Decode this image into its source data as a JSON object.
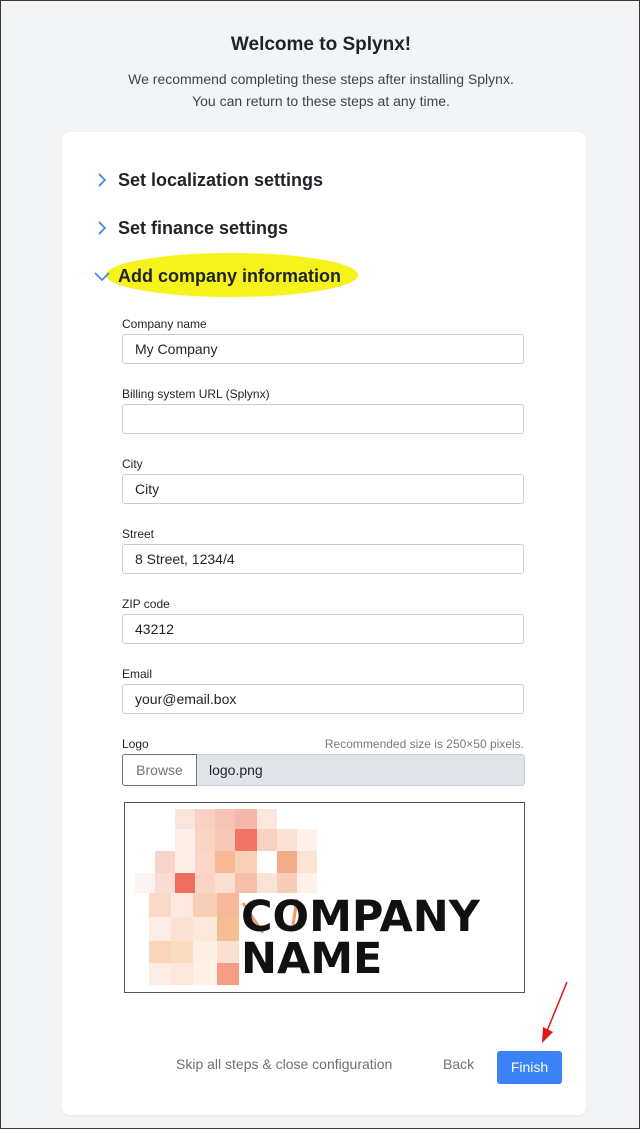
{
  "header": {
    "title": "Welcome to Splynx!",
    "subtitle_line1": "We recommend completing these steps after installing Splynx.",
    "subtitle_line2": "You can return to these steps at any time."
  },
  "sections": [
    {
      "label": "Set localization settings",
      "expanded": false
    },
    {
      "label": "Set finance settings",
      "expanded": false
    },
    {
      "label": "Add company information",
      "expanded": true
    }
  ],
  "form": {
    "company_name": {
      "label": "Company name",
      "value": "My Company"
    },
    "billing_url": {
      "label": "Billing system URL (Splynx)",
      "value": ""
    },
    "city": {
      "label": "City",
      "value": "City"
    },
    "street": {
      "label": "Street",
      "value": "8 Street, 1234/4"
    },
    "zip": {
      "label": "ZIP code",
      "value": "43212"
    },
    "email": {
      "label": "Email",
      "value": "your@email.box"
    },
    "logo": {
      "label": "Logo",
      "hint": "Recommended size is 250×50 pixels.",
      "browse_label": "Browse",
      "file_name": "logo.png",
      "preview_text_line1": "COMPANY",
      "preview_text_line2": "NAME"
    }
  },
  "footer": {
    "skip_label": "Skip all steps & close configuration",
    "back_label": "Back",
    "finish_label": "Finish"
  },
  "colors": {
    "accent": "#3b82f6",
    "highlight": "#f7f21c",
    "chevron": "#3b82f6",
    "annotation_arrow": "#e0151b"
  },
  "icons": {
    "collapsed": "chevron-right-icon",
    "expanded": "chevron-down-icon"
  }
}
